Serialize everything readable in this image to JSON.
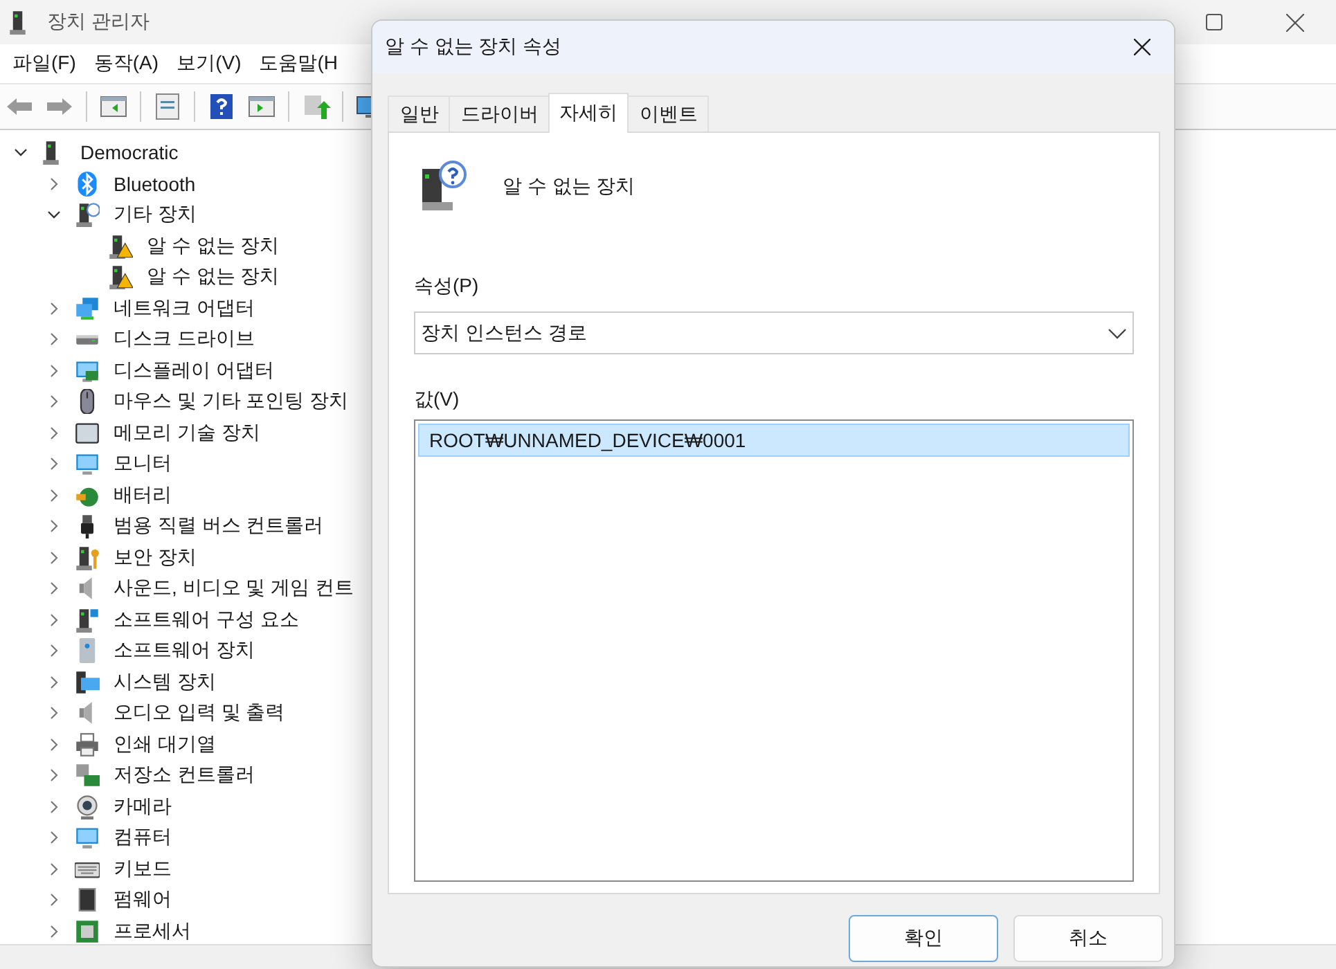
{
  "window": {
    "title": "장치 관리자"
  },
  "menu": [
    {
      "label": "파일(F)"
    },
    {
      "label": "동작(A)"
    },
    {
      "label": "보기(V)"
    },
    {
      "label": "도움말(H"
    }
  ],
  "tree": {
    "label": "Democratic",
    "expanded": true,
    "children": [
      {
        "label": "Bluetooth",
        "expanded": false
      },
      {
        "label": "기타 장치",
        "expanded": true,
        "children": [
          {
            "label": "알 수 없는 장치"
          },
          {
            "label": "알 수 없는 장치"
          }
        ]
      },
      {
        "label": "네트워크 어댑터",
        "expanded": false
      },
      {
        "label": "디스크 드라이브",
        "expanded": false
      },
      {
        "label": "디스플레이 어댑터",
        "expanded": false
      },
      {
        "label": "마우스 및 기타 포인팅 장치",
        "expanded": false
      },
      {
        "label": "메모리 기술 장치",
        "expanded": false
      },
      {
        "label": "모니터",
        "expanded": false
      },
      {
        "label": "배터리",
        "expanded": false
      },
      {
        "label": "범용 직렬 버스 컨트롤러",
        "expanded": false
      },
      {
        "label": "보안 장치",
        "expanded": false
      },
      {
        "label": "사운드, 비디오 및 게임 컨트",
        "expanded": false
      },
      {
        "label": "소프트웨어 구성 요소",
        "expanded": false
      },
      {
        "label": "소프트웨어 장치",
        "expanded": false
      },
      {
        "label": "시스템 장치",
        "expanded": false
      },
      {
        "label": "오디오 입력 및 출력",
        "expanded": false
      },
      {
        "label": "인쇄 대기열",
        "expanded": false
      },
      {
        "label": "저장소 컨트롤러",
        "expanded": false
      },
      {
        "label": "카메라",
        "expanded": false
      },
      {
        "label": "컴퓨터",
        "expanded": false
      },
      {
        "label": "키보드",
        "expanded": false
      },
      {
        "label": "펌웨어",
        "expanded": false
      },
      {
        "label": "프로세서",
        "expanded": false
      }
    ]
  },
  "dialog": {
    "title": "알 수 없는 장치 속성",
    "tabs": [
      {
        "label": "일반",
        "selected": false
      },
      {
        "label": "드라이버",
        "selected": false
      },
      {
        "label": "자세히",
        "selected": true
      },
      {
        "label": "이벤트",
        "selected": false
      }
    ],
    "device_name": "알 수 없는 장치",
    "property": {
      "label": "속성(P)",
      "value": "장치 인스턴스 경로"
    },
    "value_label": "값(V)",
    "values": [
      {
        "text": "ROOT₩UNNAMED_DEVICE₩0001",
        "selected": true
      }
    ],
    "buttons": [
      {
        "label": "확인",
        "default": true
      },
      {
        "label": "취소",
        "default": false
      }
    ]
  }
}
